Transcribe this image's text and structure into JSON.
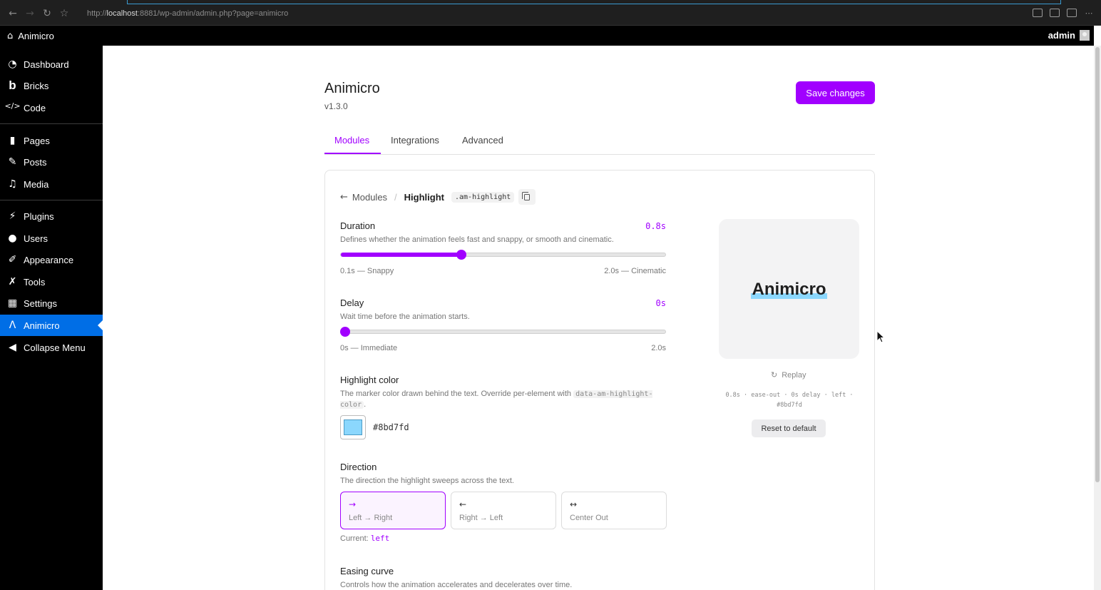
{
  "browser": {
    "url_prefix": "http://",
    "url_host": "localhost",
    "url_rest": ":8881/wp-admin/admin.php?page=animicro"
  },
  "adminbar": {
    "site_name": "Animicro",
    "user_name": "admin"
  },
  "sidebar": {
    "items": [
      {
        "label": "Dashboard",
        "icon": "dashboard-icon"
      },
      {
        "label": "Bricks",
        "icon": "bricks-icon"
      },
      {
        "label": "Code",
        "icon": "code-icon"
      },
      {
        "label": "Pages",
        "icon": "pages-icon"
      },
      {
        "label": "Posts",
        "icon": "pin-icon"
      },
      {
        "label": "Media",
        "icon": "media-icon"
      },
      {
        "label": "Plugins",
        "icon": "plugin-icon"
      },
      {
        "label": "Users",
        "icon": "user-icon"
      },
      {
        "label": "Appearance",
        "icon": "brush-icon"
      },
      {
        "label": "Tools",
        "icon": "wrench-icon"
      },
      {
        "label": "Settings",
        "icon": "settings-icon"
      },
      {
        "label": "Animicro",
        "icon": "animicro-icon",
        "active": true
      },
      {
        "label": "Collapse Menu",
        "icon": "collapse-icon"
      }
    ]
  },
  "header": {
    "title": "Animicro",
    "version": "v1.3.0",
    "save_label": "Save changes"
  },
  "tabs": [
    "Modules",
    "Integrations",
    "Advanced"
  ],
  "breadcrumb": {
    "parent": "Modules",
    "current": "Highlight",
    "class_code": ".am-highlight"
  },
  "duration": {
    "label": "Duration",
    "value": "0.8s",
    "description": "Defines whether the animation feels fast and snappy, or smooth and cinematic.",
    "min_label": "0.1s — Snappy",
    "max_label": "2.0s — Cinematic",
    "min": 0.1,
    "max": 2.0,
    "current": 0.8
  },
  "delay": {
    "label": "Delay",
    "value": "0s",
    "description": "Wait time before the animation starts.",
    "min_label": "0s — Immediate",
    "max_label": "2.0s",
    "min": 0,
    "max": 2.0,
    "current": 0
  },
  "highlight_color": {
    "label": "Highlight color",
    "description_pre": "The marker color drawn behind the text. Override per-element with ",
    "description_code": "data-am-highlight-color",
    "description_post": ".",
    "hex": "#8bd7fd",
    "color": "#8bd7fd"
  },
  "direction": {
    "label": "Direction",
    "description": "The direction the highlight sweeps across the text.",
    "options": [
      {
        "arrow": "→",
        "label": "Left → Right",
        "selected": true
      },
      {
        "arrow": "←",
        "label": "Right → Left",
        "selected": false
      },
      {
        "arrow": "↔",
        "label": "Center Out",
        "selected": false
      }
    ],
    "current_label": "Current:",
    "current_value": "left"
  },
  "easing": {
    "label": "Easing curve",
    "description": "Controls how the animation accelerates and decelerates over time."
  },
  "preview": {
    "text": "Animicro",
    "replay_label": "Replay",
    "meta_line1": "0.8s · ease-out · 0s delay · left ·",
    "meta_line2": "#8bd7fd",
    "reset_label": "Reset to default"
  },
  "colors": {
    "accent": "#a100ff",
    "wp_active": "#006ee6",
    "highlight": "#8bd7fd"
  }
}
